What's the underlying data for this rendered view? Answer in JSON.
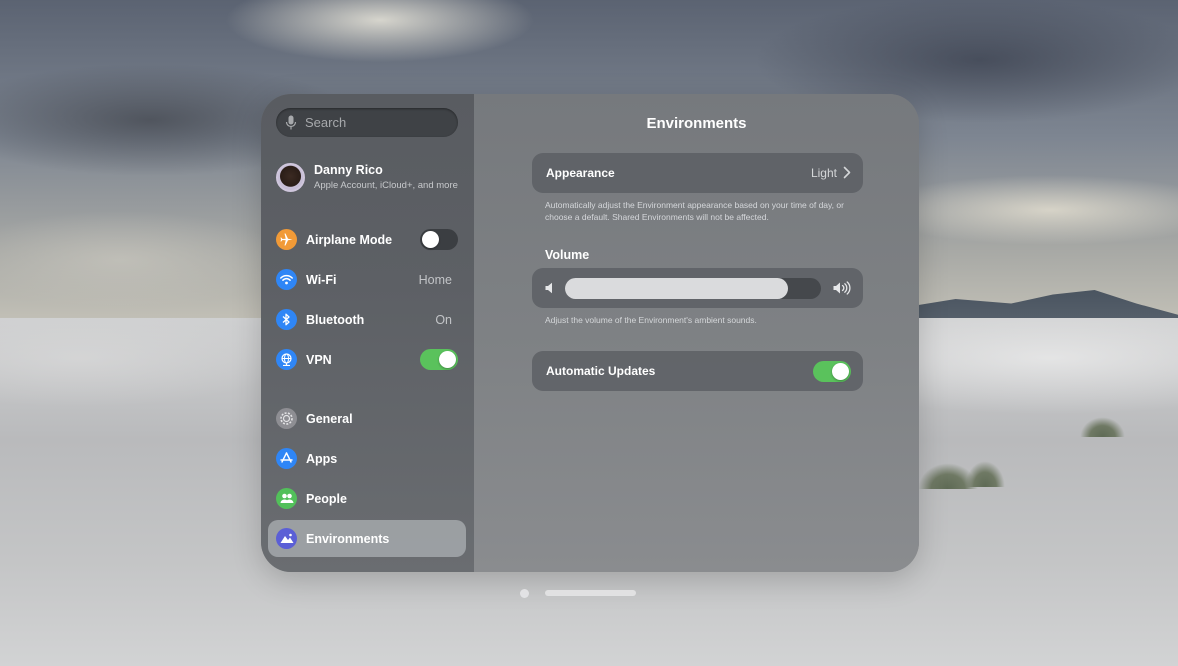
{
  "search": {
    "placeholder": "Search"
  },
  "profile": {
    "name": "Danny Rico",
    "subtitle": "Apple Account, iCloud+, and more"
  },
  "sidebar": {
    "connectivity": [
      {
        "label": "Airplane Mode",
        "icon": "airplane-icon",
        "color": "#f19a37",
        "control": "toggle",
        "on": false
      },
      {
        "label": "Wi-Fi",
        "icon": "wifi-icon",
        "color": "#2f86f6",
        "value": "Home"
      },
      {
        "label": "Bluetooth",
        "icon": "bluetooth-icon",
        "color": "#2f86f6",
        "value": "On"
      },
      {
        "label": "VPN",
        "icon": "vpn-icon",
        "color": "#2f86f6",
        "control": "toggle",
        "on": true
      }
    ],
    "settings": [
      {
        "label": "General",
        "icon": "gear-icon",
        "color": "#8e8e93"
      },
      {
        "label": "Apps",
        "icon": "app-store-icon",
        "color": "#2f86f6"
      },
      {
        "label": "People",
        "icon": "people-icon",
        "color": "#52c05a"
      },
      {
        "label": "Environments",
        "icon": "environments-icon",
        "color": "#5b5fd6",
        "selected": true
      }
    ]
  },
  "main": {
    "title": "Environments",
    "appearance": {
      "label": "Appearance",
      "value": "Light",
      "footnote": "Automatically adjust the Environment appearance based on your time of day, or choose a default. Shared Environments will not be affected."
    },
    "volume": {
      "label": "Volume",
      "level": 0.87,
      "footnote": "Adjust the volume of the Environment's ambient sounds."
    },
    "automatic_updates": {
      "label": "Automatic Updates",
      "on": true
    }
  },
  "page_indicator": {
    "pages": 2,
    "current": 1
  }
}
